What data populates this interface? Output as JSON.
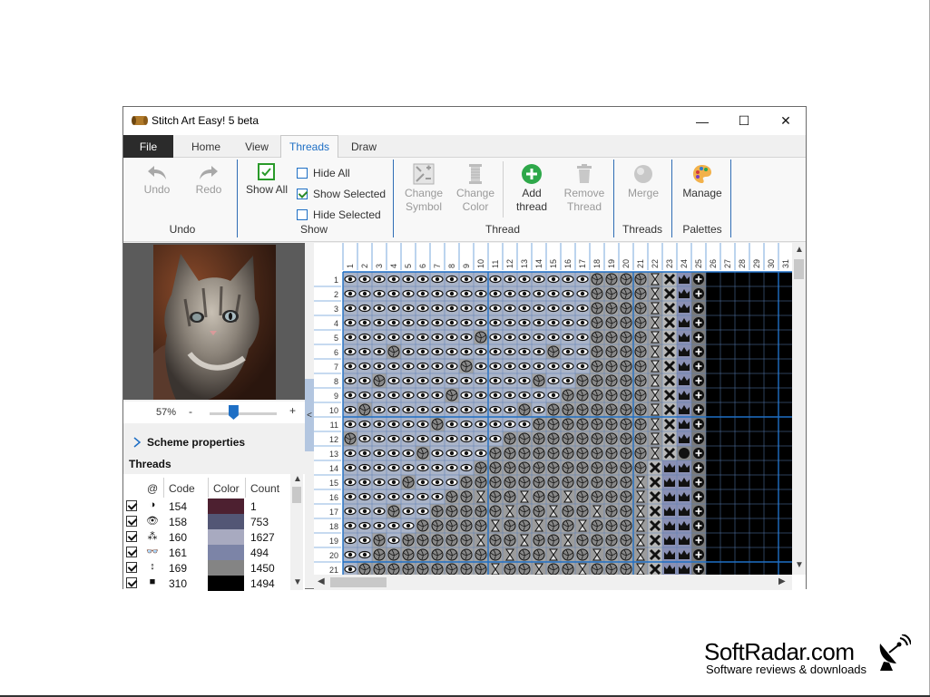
{
  "window": {
    "title": "Stitch Art Easy! 5 beta",
    "minimize": "—",
    "maximize": "☐",
    "close": "✕"
  },
  "tabs": [
    {
      "label": "File"
    },
    {
      "label": "Home"
    },
    {
      "label": "View"
    },
    {
      "label": "Threads",
      "active": true
    },
    {
      "label": "Draw"
    }
  ],
  "ribbon": {
    "undo": {
      "undo_label": "Undo",
      "redo_label": "Redo",
      "group": "Undo"
    },
    "show": {
      "show_all": "Show All",
      "hide_all": "Hide All",
      "show_selected": "Show Selected",
      "hide_selected": "Hide Selected",
      "group": "Show"
    },
    "thread": {
      "change_symbol_1": "Change",
      "change_symbol_2": "Symbol",
      "change_color_1": "Change",
      "change_color_2": "Color",
      "add_thread_1": "Add",
      "add_thread_2": "thread",
      "remove_thread_1": "Remove",
      "remove_thread_2": "Thread",
      "group": "Thread"
    },
    "threads": {
      "merge": "Merge",
      "group": "Threads"
    },
    "palettes": {
      "manage": "Manage",
      "group": "Palettes"
    }
  },
  "left_panel": {
    "zoom": "57%",
    "zoom_minus": "-",
    "zoom_plus": "+",
    "zoom_level": 0.35,
    "scheme_properties": "Scheme properties",
    "threads_title": "Threads",
    "collapse": "<",
    "columns": {
      "at": "@",
      "code": "Code",
      "color": "Color",
      "count": "Count"
    },
    "rows": [
      {
        "symbol": "◑",
        "code": "154",
        "color": "#4d2030",
        "count": "1"
      },
      {
        "symbol": "👁",
        "code": "158",
        "color": "#535675",
        "count": "753"
      },
      {
        "symbol": "⁂",
        "code": "160",
        "color": "#a8aac0",
        "count": "1627"
      },
      {
        "symbol": "👓",
        "code": "161",
        "color": "#7c84a7",
        "count": "494"
      },
      {
        "symbol": "↕",
        "code": "169",
        "color": "#848484",
        "count": "1450"
      },
      {
        "symbol": "■",
        "code": "310",
        "color": "#000000",
        "count": "1494"
      }
    ]
  },
  "grid": {
    "column_numbers": [
      "1",
      "2",
      "3",
      "4",
      "5",
      "6",
      "7",
      "8",
      "9",
      "10",
      "11",
      "12",
      "13",
      "14",
      "15",
      "16",
      "17",
      "18",
      "19",
      "20",
      "21",
      "22",
      "23",
      "24",
      "25",
      "26",
      "27",
      "28",
      "29",
      "30",
      "31"
    ],
    "row_numbers": [
      "1",
      "2",
      "3",
      "4",
      "5",
      "6",
      "7",
      "8",
      "9",
      "10",
      "11",
      "12",
      "13",
      "14",
      "15",
      "16",
      "17",
      "18",
      "19",
      "20",
      "21"
    ]
  },
  "brand": {
    "name": "SoftRadar.com",
    "tagline": "Software reviews & downloads"
  }
}
